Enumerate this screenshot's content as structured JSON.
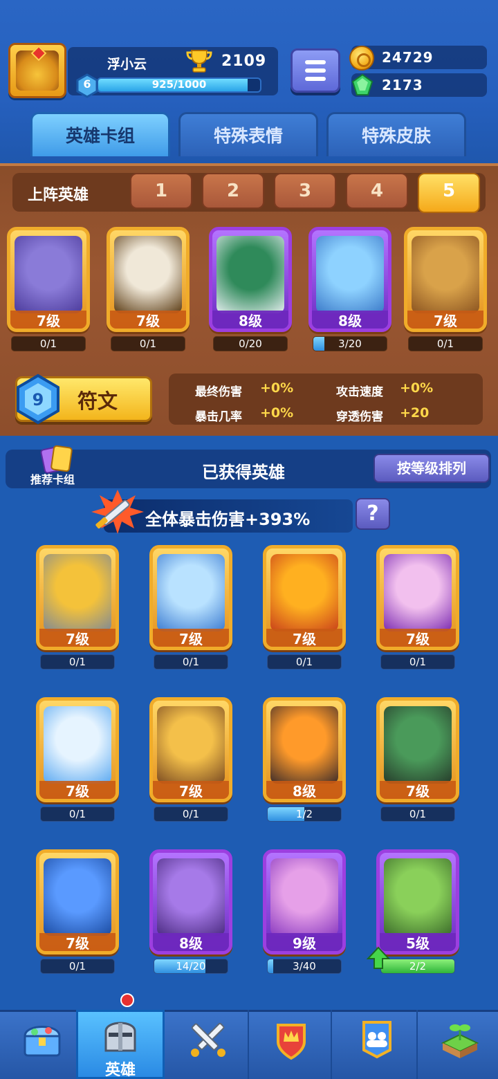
{
  "header": {
    "player_name": "浮小云",
    "trophies": "2109",
    "level": "6",
    "xp_text": "925/1000",
    "xp_fraction": 0.925,
    "coins": "24729",
    "gems": "2173"
  },
  "tabs": [
    {
      "label": "英雄卡组",
      "active": true
    },
    {
      "label": "特殊表情",
      "active": false
    },
    {
      "label": "特殊皮肤",
      "active": false
    }
  ],
  "lineup": {
    "label": "上阵英雄",
    "slots": [
      "1",
      "2",
      "3",
      "4",
      "5"
    ],
    "active_slot": "5",
    "heroes": [
      {
        "level": "7级",
        "progress": "0/1",
        "fraction": 0,
        "rarity": "gold",
        "icon": "octopus-pirate-hero-icon"
      },
      {
        "level": "7级",
        "progress": "0/1",
        "fraction": 0,
        "rarity": "gold",
        "icon": "hooded-mage-hero-icon"
      },
      {
        "level": "8级",
        "progress": "0/20",
        "fraction": 0,
        "rarity": "purple",
        "icon": "skull-gangster-hero-icon"
      },
      {
        "level": "8级",
        "progress": "3/20",
        "fraction": 0.15,
        "rarity": "purple",
        "icon": "ice-warrior-hero-icon"
      },
      {
        "level": "7级",
        "progress": "0/1",
        "fraction": 0,
        "rarity": "gold",
        "icon": "tree-guardian-hero-icon"
      }
    ]
  },
  "rune": {
    "label": "符文"
  },
  "stats": [
    {
      "label": "最终伤害",
      "value": "+0%"
    },
    {
      "label": "攻击速度",
      "value": "+0%"
    },
    {
      "label": "暴击几率",
      "value": "+0%"
    },
    {
      "label": "穿透伤害",
      "value": "+20"
    }
  ],
  "collection": {
    "deck_label": "推荐卡组",
    "title": "已获得英雄",
    "sort_label": "按等级排列",
    "crit_text": "全体暴击伤害+393%",
    "help_label": "?",
    "heroes": [
      {
        "level": "7级",
        "progress": "0/1",
        "fraction": 0,
        "rarity": "gold",
        "icon": "knight-helmet-hero-icon"
      },
      {
        "level": "7级",
        "progress": "0/1",
        "fraction": 0,
        "rarity": "gold",
        "icon": "zeus-hero-icon"
      },
      {
        "level": "7级",
        "progress": "0/1",
        "fraction": 0,
        "rarity": "gold",
        "icon": "pumpkin-hero-icon"
      },
      {
        "level": "7级",
        "progress": "0/1",
        "fraction": 0,
        "rarity": "gold",
        "icon": "skull-reaper-hero-icon"
      },
      {
        "level": "7级",
        "progress": "0/1",
        "fraction": 0,
        "rarity": "gold",
        "icon": "yeti-hero-icon"
      },
      {
        "level": "7级",
        "progress": "0/1",
        "fraction": 0,
        "rarity": "gold",
        "icon": "cowboy-hero-icon"
      },
      {
        "level": "8级",
        "progress": "1/2",
        "fraction": 0.5,
        "rarity": "gold",
        "icon": "lava-golem-hero-icon"
      },
      {
        "level": "7级",
        "progress": "0/1",
        "fraction": 0,
        "rarity": "gold",
        "icon": "zombie-hero-icon"
      },
      {
        "level": "7级",
        "progress": "0/1",
        "fraction": 0,
        "rarity": "gold",
        "icon": "frost-beard-hero-icon"
      },
      {
        "level": "8级",
        "progress": "14/20",
        "fraction": 0.7,
        "rarity": "purple",
        "icon": "magician-hero-icon"
      },
      {
        "level": "9级",
        "progress": "3/40",
        "fraction": 0.075,
        "rarity": "purple",
        "icon": "sorceress-hero-icon"
      },
      {
        "level": "5级",
        "progress": "2/2",
        "fraction": 1,
        "rarity": "purple",
        "icon": "ranger-hero-icon",
        "upgradable": true
      }
    ]
  },
  "nav": [
    {
      "label": "",
      "icon": "treasure-chest-icon"
    },
    {
      "label": "英雄",
      "icon": "knight-helmet-icon",
      "active": true
    },
    {
      "label": "",
      "icon": "crossed-swords-icon"
    },
    {
      "label": "",
      "icon": "crown-shield-icon"
    },
    {
      "label": "",
      "icon": "guild-banner-icon"
    },
    {
      "label": "",
      "icon": "sprout-island-icon"
    }
  ],
  "colors": {
    "gold_frame": "#f0ac2a",
    "purple_frame": "#9c3fe0",
    "wood": "#8a4d2a",
    "blue_bg": "#1e5cb3"
  }
}
